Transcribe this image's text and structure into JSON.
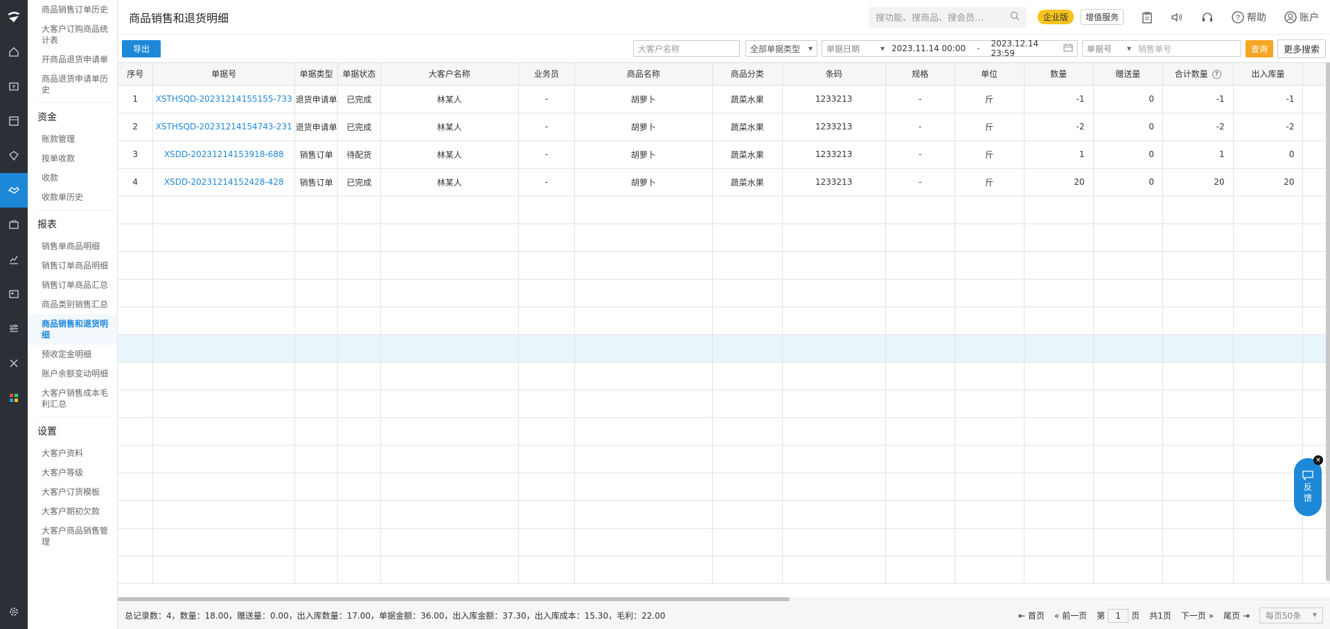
{
  "page_title": "商品销售和退货明细",
  "colors": {
    "accent": "#1e88d8",
    "query": "#f5a623",
    "enterprise": "#f7c21a",
    "rail": "#2b2f36"
  },
  "header": {
    "search_placeholder": "搜功能、搜商品、搜会员…",
    "enterprise_badge": "企业版",
    "value_added": "增值服务",
    "help": "帮助",
    "account": "账户"
  },
  "menu": {
    "top_items": [
      "商品销售订单历史",
      "大客户订购商品统计表",
      "开商品退货申请单",
      "商品退货申请单历史"
    ],
    "groups": [
      {
        "title": "资金",
        "items": [
          "账款管理",
          "按单收款",
          "收款",
          "收款单历史"
        ]
      },
      {
        "title": "报表",
        "items": [
          "销售单商品明细",
          "销售订单商品明细",
          "销售订单商品汇总",
          "商品类别销售汇总",
          "商品销售和退货明细",
          "预收定金明细",
          "账户余额变动明细",
          "大客户销售成本毛利汇总"
        ]
      },
      {
        "title": "设置",
        "items": [
          "大客户资料",
          "大客户等级",
          "大客户订货模板",
          "大客户期初欠款",
          "大客户商品销售管理"
        ]
      }
    ],
    "active": "商品销售和退货明细"
  },
  "toolbar": {
    "export": "导出",
    "customer_placeholder": "大客户名称",
    "doc_type": "全部单据类型",
    "date_type": "单据日期",
    "date_from": "2023.11.14 00:00",
    "date_sep": "-",
    "date_to": "2023.12.14 23:59",
    "field_select": "单据号",
    "doc_no_placeholder": "销售单号",
    "query": "查询",
    "more": "更多搜索"
  },
  "table": {
    "columns": [
      "序号",
      "单据号",
      "单据类型",
      "单据状态",
      "大客户名称",
      "业务员",
      "商品名称",
      "商品分类",
      "条码",
      "规格",
      "单位",
      "数量",
      "赠送量",
      "合计数量",
      "出入库量"
    ],
    "rows": [
      [
        "1",
        "XSTHSQD-20231214155155-733",
        "退货申请单",
        "已完成",
        "林某人",
        "-",
        "胡萝卜",
        "蔬菜水果",
        "1233213",
        "-",
        "斤",
        "-1",
        "0",
        "-1",
        "-1"
      ],
      [
        "2",
        "XSTHSQD-20231214154743-231",
        "退货申请单",
        "已完成",
        "林某人",
        "-",
        "胡萝卜",
        "蔬菜水果",
        "1233213",
        "-",
        "斤",
        "-2",
        "0",
        "-2",
        "-2"
      ],
      [
        "3",
        "XSDD-20231214153918-688",
        "销售订单",
        "待配货",
        "林某人",
        "-",
        "胡萝卜",
        "蔬菜水果",
        "1233213",
        "-",
        "斤",
        "1",
        "0",
        "1",
        "0"
      ],
      [
        "4",
        "XSDD-20231214152428-428",
        "销售订单",
        "已完成",
        "林某人",
        "-",
        "胡萝卜",
        "蔬菜水果",
        "1233213",
        "-",
        "斤",
        "20",
        "0",
        "20",
        "20"
      ]
    ]
  },
  "footer": {
    "summary": "总记录数：4，数量：18.00，赠送量：0.00，出入库数量：17.00，单据金额：36.00，出入库金额：37.30，出入库成本：15.30，毛利：22.00",
    "first": "首页",
    "prev": "前一页",
    "page_prefix": "第",
    "page": "1",
    "page_suffix": "页",
    "total_pages": "共1页",
    "next": "下一页",
    "last": "尾页",
    "page_size": "每页50条"
  },
  "feedback": "反馈"
}
